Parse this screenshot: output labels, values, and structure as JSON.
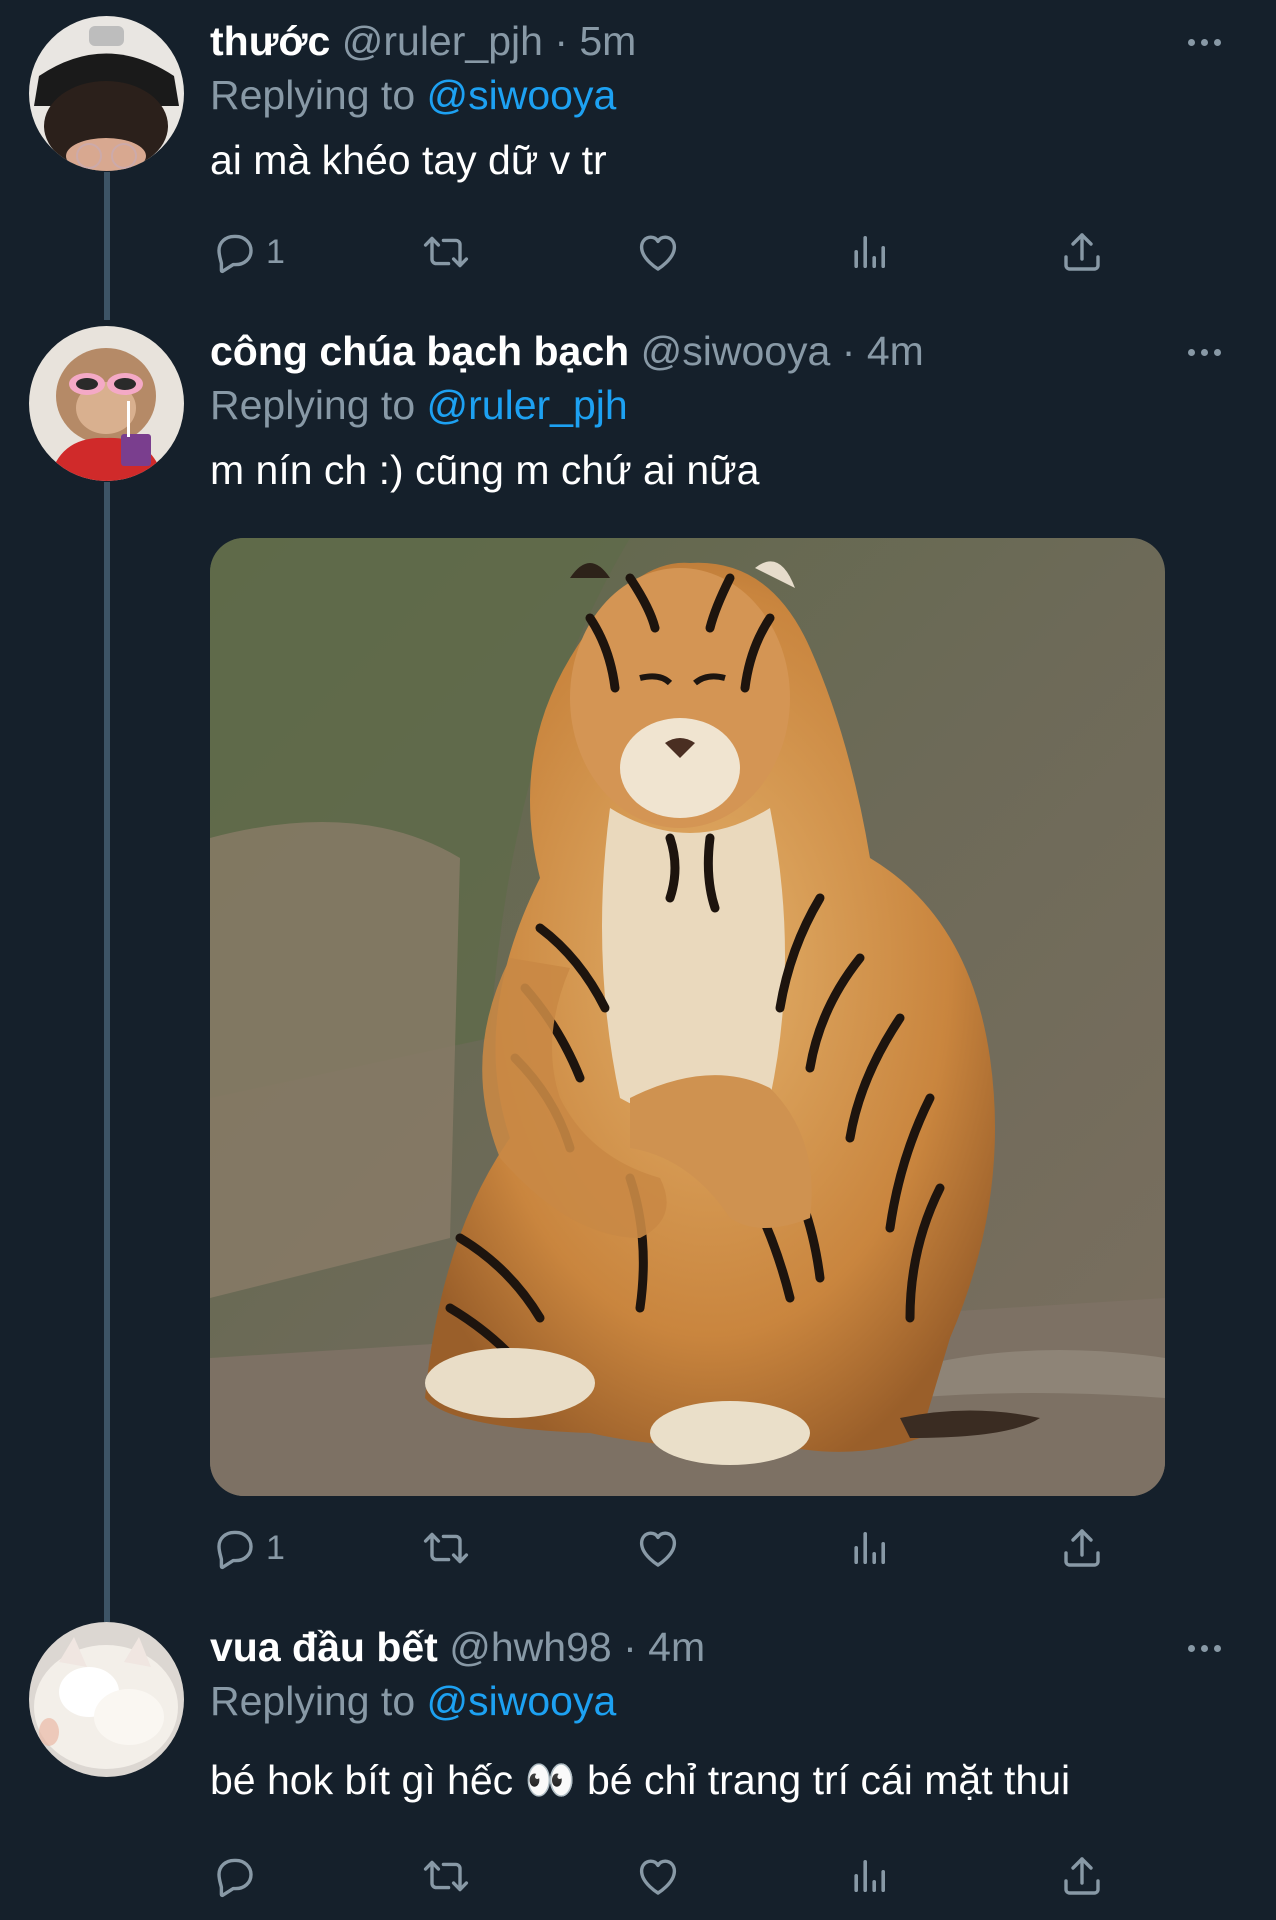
{
  "tweets": [
    {
      "display_name": "thước",
      "handle": "@ruler_pjh",
      "separator": "·",
      "time": "5m",
      "replying_prefix": "Replying to",
      "replying_to": "@siwooya",
      "text": "ai mà khéo tay dữ v tr",
      "reply_count": "1",
      "retweet_count": "",
      "like_count": ""
    },
    {
      "display_name": "công chúa bạch bạch",
      "handle": "@siwooya",
      "separator": "·",
      "time": "4m",
      "replying_prefix": "Replying to",
      "replying_to": "@ruler_pjh",
      "text": "m nín ch :) cũng m chứ ai nữa",
      "reply_count": "1",
      "retweet_count": "",
      "like_count": ""
    },
    {
      "display_name": "vua đầu bết",
      "handle": "@hwh98",
      "separator": "·",
      "time": "4m",
      "replying_prefix": "Replying to",
      "replying_to": "@siwooya",
      "text": "bé hok bít gì hếc 👀 bé chỉ trang trí cái mặt thui",
      "reply_count": "",
      "retweet_count": "",
      "like_count": ""
    }
  ],
  "icons": {
    "reply": "reply-icon",
    "retweet": "retweet-icon",
    "like": "heart-icon",
    "analytics": "analytics-icon",
    "share": "share-icon",
    "more": "more-icon"
  },
  "colors": {
    "background": "#15202b",
    "secondary_text": "#8899a6",
    "mention": "#1da1f2",
    "thread_line": "#3d5466"
  }
}
